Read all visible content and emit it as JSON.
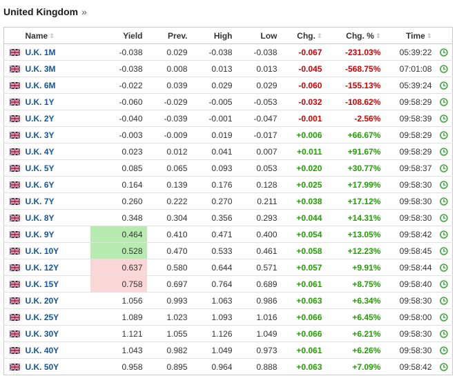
{
  "page": {
    "title": "United Kingdom",
    "title_arrow": "»"
  },
  "table": {
    "headers": {
      "name": "Name",
      "yield": "Yield",
      "prev": "Prev.",
      "high": "High",
      "low": "Low",
      "chg": "Chg.",
      "chg_pct": "Chg. %",
      "time": "Time"
    },
    "sort_glyph": "⇕",
    "colors": {
      "up": "#21a000",
      "down": "#d40000",
      "link": "#1256a0",
      "highlight_up": "#b7ebb0",
      "highlight_down": "#fbd6d6"
    },
    "rows": [
      {
        "name": "U.K. 1M",
        "yield": "-0.038",
        "prev": "0.029",
        "high": "-0.038",
        "low": "-0.038",
        "chg": "-0.067",
        "chg_pct": "-231.03%",
        "time": "05:39:22",
        "dir": "down",
        "highlight": ""
      },
      {
        "name": "U.K. 3M",
        "yield": "-0.038",
        "prev": "0.008",
        "high": "0.013",
        "low": "0.013",
        "chg": "-0.045",
        "chg_pct": "-568.75%",
        "time": "07:01:08",
        "dir": "down",
        "highlight": ""
      },
      {
        "name": "U.K. 6M",
        "yield": "-0.022",
        "prev": "0.039",
        "high": "0.029",
        "low": "0.029",
        "chg": "-0.060",
        "chg_pct": "-155.13%",
        "time": "05:39:24",
        "dir": "down",
        "highlight": ""
      },
      {
        "name": "U.K. 1Y",
        "yield": "-0.060",
        "prev": "-0.029",
        "high": "-0.005",
        "low": "-0.053",
        "chg": "-0.032",
        "chg_pct": "-108.62%",
        "time": "09:58:29",
        "dir": "down",
        "highlight": ""
      },
      {
        "name": "U.K. 2Y",
        "yield": "-0.040",
        "prev": "-0.039",
        "high": "-0.001",
        "low": "-0.047",
        "chg": "-0.001",
        "chg_pct": "-2.56%",
        "time": "09:58:39",
        "dir": "down",
        "highlight": ""
      },
      {
        "name": "U.K. 3Y",
        "yield": "-0.003",
        "prev": "-0.009",
        "high": "0.019",
        "low": "-0.017",
        "chg": "+0.006",
        "chg_pct": "+66.67%",
        "time": "09:58:29",
        "dir": "up",
        "highlight": ""
      },
      {
        "name": "U.K. 4Y",
        "yield": "0.023",
        "prev": "0.012",
        "high": "0.041",
        "low": "0.007",
        "chg": "+0.011",
        "chg_pct": "+91.67%",
        "time": "09:58:29",
        "dir": "up",
        "highlight": ""
      },
      {
        "name": "U.K. 5Y",
        "yield": "0.085",
        "prev": "0.065",
        "high": "0.093",
        "low": "0.053",
        "chg": "+0.020",
        "chg_pct": "+30.77%",
        "time": "09:58:37",
        "dir": "up",
        "highlight": ""
      },
      {
        "name": "U.K. 6Y",
        "yield": "0.164",
        "prev": "0.139",
        "high": "0.176",
        "low": "0.128",
        "chg": "+0.025",
        "chg_pct": "+17.99%",
        "time": "09:58:30",
        "dir": "up",
        "highlight": ""
      },
      {
        "name": "U.K. 7Y",
        "yield": "0.260",
        "prev": "0.222",
        "high": "0.270",
        "low": "0.211",
        "chg": "+0.038",
        "chg_pct": "+17.12%",
        "time": "09:58:30",
        "dir": "up",
        "highlight": ""
      },
      {
        "name": "U.K. 8Y",
        "yield": "0.348",
        "prev": "0.304",
        "high": "0.356",
        "low": "0.293",
        "chg": "+0.044",
        "chg_pct": "+14.31%",
        "time": "09:58:30",
        "dir": "up",
        "highlight": ""
      },
      {
        "name": "U.K. 9Y",
        "yield": "0.464",
        "prev": "0.410",
        "high": "0.471",
        "low": "0.400",
        "chg": "+0.054",
        "chg_pct": "+13.05%",
        "time": "09:58:42",
        "dir": "up",
        "highlight": "up"
      },
      {
        "name": "U.K. 10Y",
        "yield": "0.528",
        "prev": "0.470",
        "high": "0.533",
        "low": "0.461",
        "chg": "+0.058",
        "chg_pct": "+12.23%",
        "time": "09:58:45",
        "dir": "up",
        "highlight": "up"
      },
      {
        "name": "U.K. 12Y",
        "yield": "0.637",
        "prev": "0.580",
        "high": "0.644",
        "low": "0.571",
        "chg": "+0.057",
        "chg_pct": "+9.91%",
        "time": "09:58:44",
        "dir": "up",
        "highlight": "down"
      },
      {
        "name": "U.K. 15Y",
        "yield": "0.758",
        "prev": "0.697",
        "high": "0.764",
        "low": "0.689",
        "chg": "+0.061",
        "chg_pct": "+8.75%",
        "time": "09:58:40",
        "dir": "up",
        "highlight": "down"
      },
      {
        "name": "U.K. 20Y",
        "yield": "1.056",
        "prev": "0.993",
        "high": "1.063",
        "low": "0.986",
        "chg": "+0.063",
        "chg_pct": "+6.34%",
        "time": "09:58:30",
        "dir": "up",
        "highlight": ""
      },
      {
        "name": "U.K. 25Y",
        "yield": "1.089",
        "prev": "1.023",
        "high": "1.093",
        "low": "1.016",
        "chg": "+0.066",
        "chg_pct": "+6.45%",
        "time": "09:58:00",
        "dir": "up",
        "highlight": ""
      },
      {
        "name": "U.K. 30Y",
        "yield": "1.121",
        "prev": "1.055",
        "high": "1.126",
        "low": "1.049",
        "chg": "+0.066",
        "chg_pct": "+6.21%",
        "time": "09:58:30",
        "dir": "up",
        "highlight": ""
      },
      {
        "name": "U.K. 40Y",
        "yield": "1.043",
        "prev": "0.982",
        "high": "1.049",
        "low": "0.973",
        "chg": "+0.061",
        "chg_pct": "+6.26%",
        "time": "09:58:30",
        "dir": "up",
        "highlight": ""
      },
      {
        "name": "U.K. 50Y",
        "yield": "0.958",
        "prev": "0.895",
        "high": "0.964",
        "low": "0.888",
        "chg": "+0.063",
        "chg_pct": "+7.09%",
        "time": "09:58:42",
        "dir": "up",
        "highlight": ""
      }
    ]
  },
  "icons": {
    "flag": "uk-flag-icon",
    "clock": "clock-icon",
    "sort": "sort-arrows-icon"
  }
}
